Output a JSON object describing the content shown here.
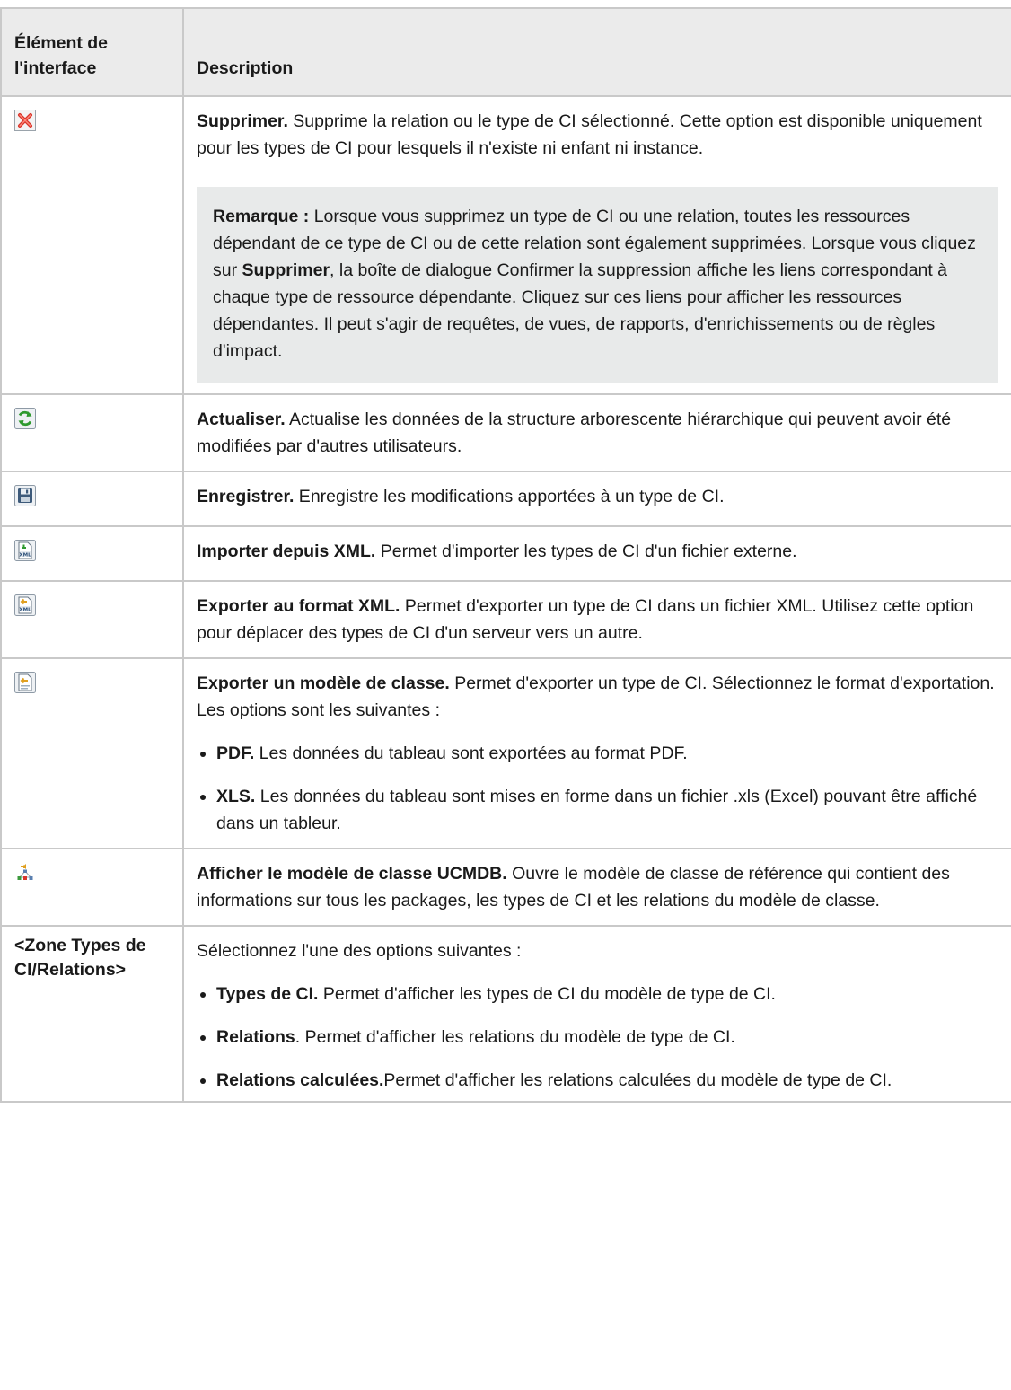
{
  "header": {
    "col1": "Élément de l'interface",
    "col2": "Description"
  },
  "rows": {
    "delete": {
      "icon": "delete-x-icon",
      "title": "Supprimer.",
      "text": " Supprime la relation ou le type de CI sélectionné. Cette option est disponible uniquement pour les types de CI pour lesquels il n'existe ni enfant ni instance.",
      "note": {
        "label": "Remarque :",
        "text_a": " Lorsque vous supprimez un type de CI ou une relation, toutes les ressources dépendant de ce type de CI ou de cette relation sont également supprimées. Lorsque vous cliquez sur ",
        "bold": "Supprimer",
        "text_b": ", la boîte de dialogue Confirmer la suppression affiche les liens correspondant à chaque type de ressource dépendante. Cliquez sur ces liens pour afficher les ressources dépendantes. Il peut s'agir de requêtes, de vues, de rapports, d'enrichissements ou de règles d'impact."
      }
    },
    "refresh": {
      "icon": "refresh-icon",
      "title": "Actualiser.",
      "text": " Actualise les données de la structure arborescente hiérarchique qui peuvent avoir été modifiées par d'autres utilisateurs."
    },
    "save": {
      "icon": "save-disk-icon",
      "title": "Enregistrer.",
      "text": " Enregistre les modifications apportées à un type de CI."
    },
    "import_xml": {
      "icon": "import-xml-icon",
      "title": "Importer depuis XML.",
      "text": " Permet d'importer les types de CI d'un fichier externe."
    },
    "export_xml": {
      "icon": "export-xml-icon",
      "title": "Exporter au format XML.",
      "text": " Permet d'exporter un type de CI dans un fichier XML. Utilisez cette option pour déplacer des types de CI d'un serveur vers un autre."
    },
    "export_model": {
      "icon": "export-class-model-icon",
      "title": "Exporter un modèle de classe.",
      "text": " Permet d'exporter un type de CI. Sélectionnez le format d'exportation. Les options sont les suivantes :",
      "options": [
        {
          "label": "PDF.",
          "text": " Les données du tableau sont exportées au format PDF."
        },
        {
          "label": "XLS.",
          "text": " Les données du tableau sont mises en forme dans un fichier .xls (Excel) pouvant être affiché dans un tableur."
        }
      ]
    },
    "show_model": {
      "icon": "class-model-icon",
      "title": "Afficher le modèle de classe UCMDB.",
      "text": " Ouvre le modèle de classe de référence qui contient des informations sur tous les packages, les types de CI et les relations du modèle de classe."
    },
    "zone": {
      "label": "<Zone Types de CI/Relations>",
      "intro": "Sélectionnez l'une des options suivantes :",
      "options": [
        {
          "label": "Types de CI.",
          "text": " Permet d'afficher les types de CI du modèle de type de CI."
        },
        {
          "label": "Relations",
          "text": ". Permet d'afficher les relations du modèle de type de CI."
        },
        {
          "label": "Relations calculées.",
          "text": "Permet d'afficher les relations calculées du modèle de type de CI."
        }
      ]
    }
  }
}
